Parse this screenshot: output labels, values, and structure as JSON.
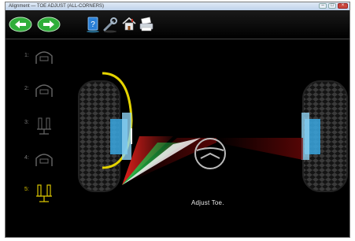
{
  "window": {
    "title": "Alignment — TOE ADJUST (ALL-CORNERS)",
    "controls": [
      "minimize",
      "maximize",
      "close"
    ]
  },
  "toolbar": {
    "back_icon": "arrow-left-icon",
    "forward_icon": "arrow-right-icon",
    "tools": [
      "help-book-icon",
      "wrench-icon",
      "home-icon",
      "printer-icon"
    ]
  },
  "steps": [
    {
      "label": "1:",
      "icon": "camber-gauge-icon"
    },
    {
      "label": "2:",
      "icon": "caster-gauge-icon"
    },
    {
      "label": "3:",
      "icon": "lift-icon"
    },
    {
      "label": "4:",
      "icon": "wheel-gauge-icon"
    },
    {
      "label": "5:",
      "icon": "toe-icon",
      "active": true
    }
  ],
  "status": {
    "instruction": "Adjust Toe."
  },
  "colors": {
    "background": "#000000",
    "nav_green": "#2fae3a",
    "highlight_yellow": "#d8c300",
    "toe_red": "#e0201c",
    "toe_green": "#22c24a",
    "rim_blue": "#3aa7e0"
  }
}
